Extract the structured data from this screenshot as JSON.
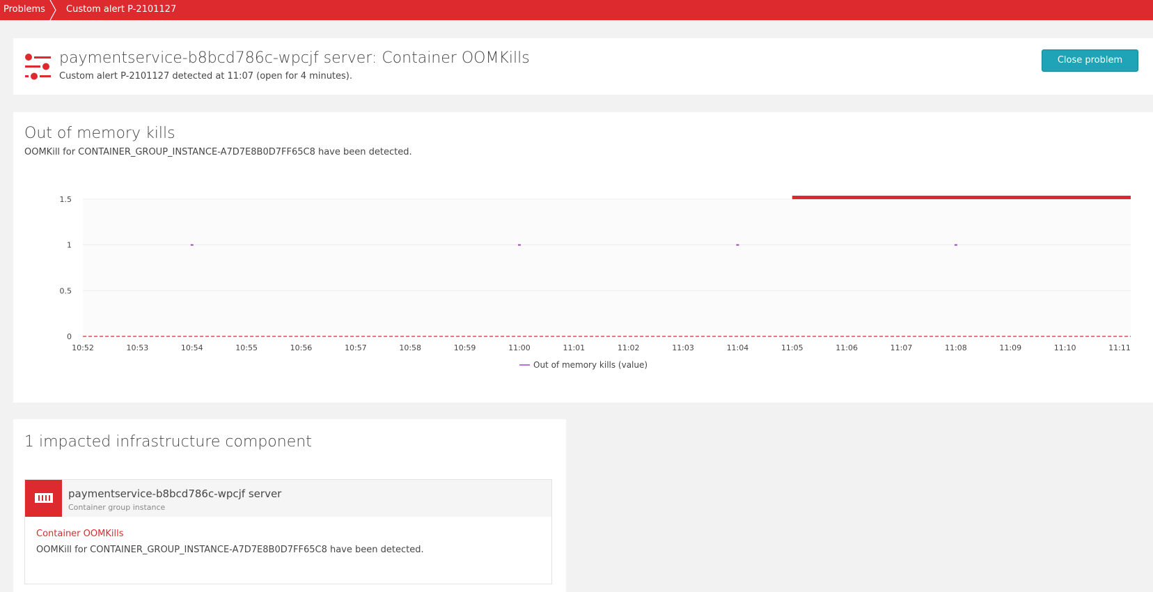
{
  "breadcrumb": {
    "items": [
      "Problems",
      "Custom alert P-2101127"
    ]
  },
  "header": {
    "title": "paymentservice-b8bcd786c-wpcjf server: Container OOMKills",
    "subtitle": "Custom alert P-2101127 detected at 11:07 (open for 4 minutes).",
    "close_label": "Close problem",
    "icon": "problem-sliders-icon"
  },
  "chart_section": {
    "title": "Out of memory kills",
    "description": "OOMKill for CONTAINER_GROUP_INSTANCE-A7D7E8B0D7FF65C8 have been detected."
  },
  "chart_data": {
    "type": "line",
    "title": "",
    "xlabel": "",
    "ylabel": "",
    "x_ticks": [
      "10:52",
      "10:53",
      "10:54",
      "10:55",
      "10:56",
      "10:57",
      "10:58",
      "10:59",
      "11:00",
      "11:01",
      "11:02",
      "11:03",
      "11:04",
      "11:05",
      "11:06",
      "11:07",
      "11:08",
      "11:09",
      "11:10",
      "11:11"
    ],
    "y_ticks": [
      "0",
      "0.5",
      "1",
      "1.5"
    ],
    "ylim": [
      0,
      1.5
    ],
    "grid": true,
    "legend_position": "bottom",
    "series": [
      {
        "name": "Out of memory kills (value)",
        "color": "#a442c9",
        "points": [
          {
            "x": "10:54",
            "y": 1
          },
          {
            "x": "11:00",
            "y": 1
          },
          {
            "x": "11:04",
            "y": 1
          },
          {
            "x": "11:08",
            "y": 1
          }
        ]
      }
    ],
    "threshold": {
      "value": 0,
      "style": "dashed",
      "color": "#dc2a2f"
    },
    "problem_period": {
      "start": "11:05",
      "end": "11:11",
      "color": "#dc2a2f"
    }
  },
  "impact": {
    "title": "1 impacted infrastructure component",
    "entity": {
      "name": "paymentservice-b8bcd786c-wpcjf server",
      "type": "Container group instance",
      "icon": "container-icon",
      "issue_title": "Container OOMKills",
      "issue_description": "OOMKill for CONTAINER_GROUP_INSTANCE-A7D7E8B0D7FF65C8 have been detected."
    }
  },
  "colors": {
    "brand_red": "#dc2a2f",
    "button_teal": "#1ea3b7",
    "series_purple": "#a442c9"
  }
}
